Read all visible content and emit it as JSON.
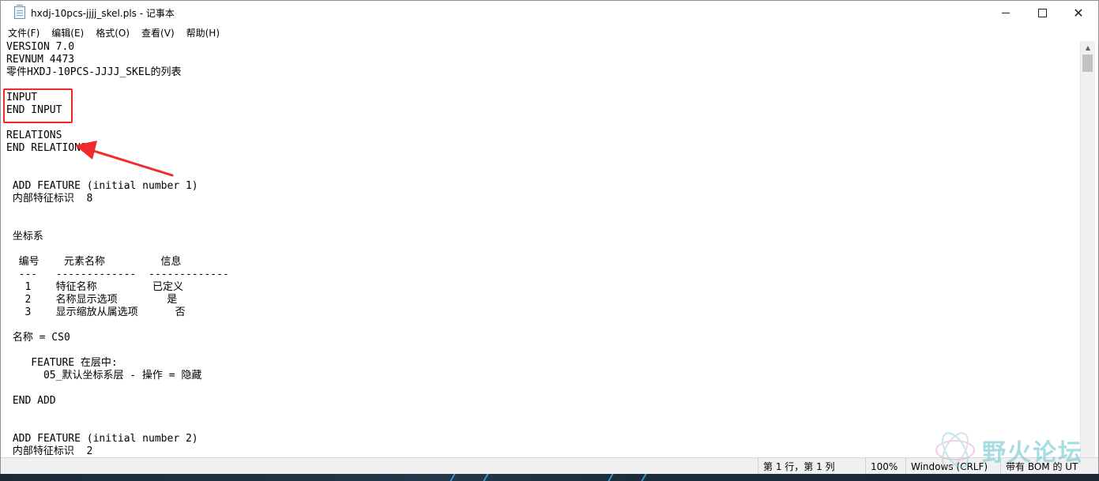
{
  "window": {
    "title": "hxdj-10pcs-jjjj_skel.pls - 记事本",
    "controls": {
      "minimize": "minimize",
      "maximize": "maximize",
      "close": "✕"
    }
  },
  "menu": [
    {
      "label": "文件(F)"
    },
    {
      "label": "编辑(E)"
    },
    {
      "label": "格式(O)"
    },
    {
      "label": "查看(V)"
    },
    {
      "label": "帮助(H)"
    }
  ],
  "editor": {
    "lines": [
      "VERSION 7.0",
      "REVNUM 4473",
      "零件HXDJ-10PCS-JJJJ_SKEL的列表",
      "",
      "INPUT",
      "END INPUT",
      "",
      "RELATIONS",
      "END RELATIONS",
      "",
      "",
      " ADD FEATURE (initial number 1)",
      " 内部特征标识  8",
      "",
      "",
      " 坐标系",
      "",
      "  编号    元素名称         信息",
      "  ---   -------------  -------------",
      "   1    特征名称         已定义",
      "   2    名称显示选项        是",
      "   3    显示缩放从属选项      否",
      "",
      " 名称 = CS0",
      "",
      "    FEATURE 在层中:",
      "      05_默认坐标系层 - 操作 = 隐藏",
      "",
      " END ADD",
      "",
      "",
      " ADD FEATURE (initial number 2)",
      " 内部特征标识  2"
    ]
  },
  "status": {
    "position": "第 1 行，第 1 列",
    "zoom": "100%",
    "line_ending": "Windows (CRLF)",
    "encoding": "带有 BOM 的 UT"
  },
  "watermark": {
    "text": "野火论坛"
  },
  "colors": {
    "annotation": "#ef2b2b",
    "window_bg": "#ffffff",
    "status_bg": "#f0f0f0"
  }
}
